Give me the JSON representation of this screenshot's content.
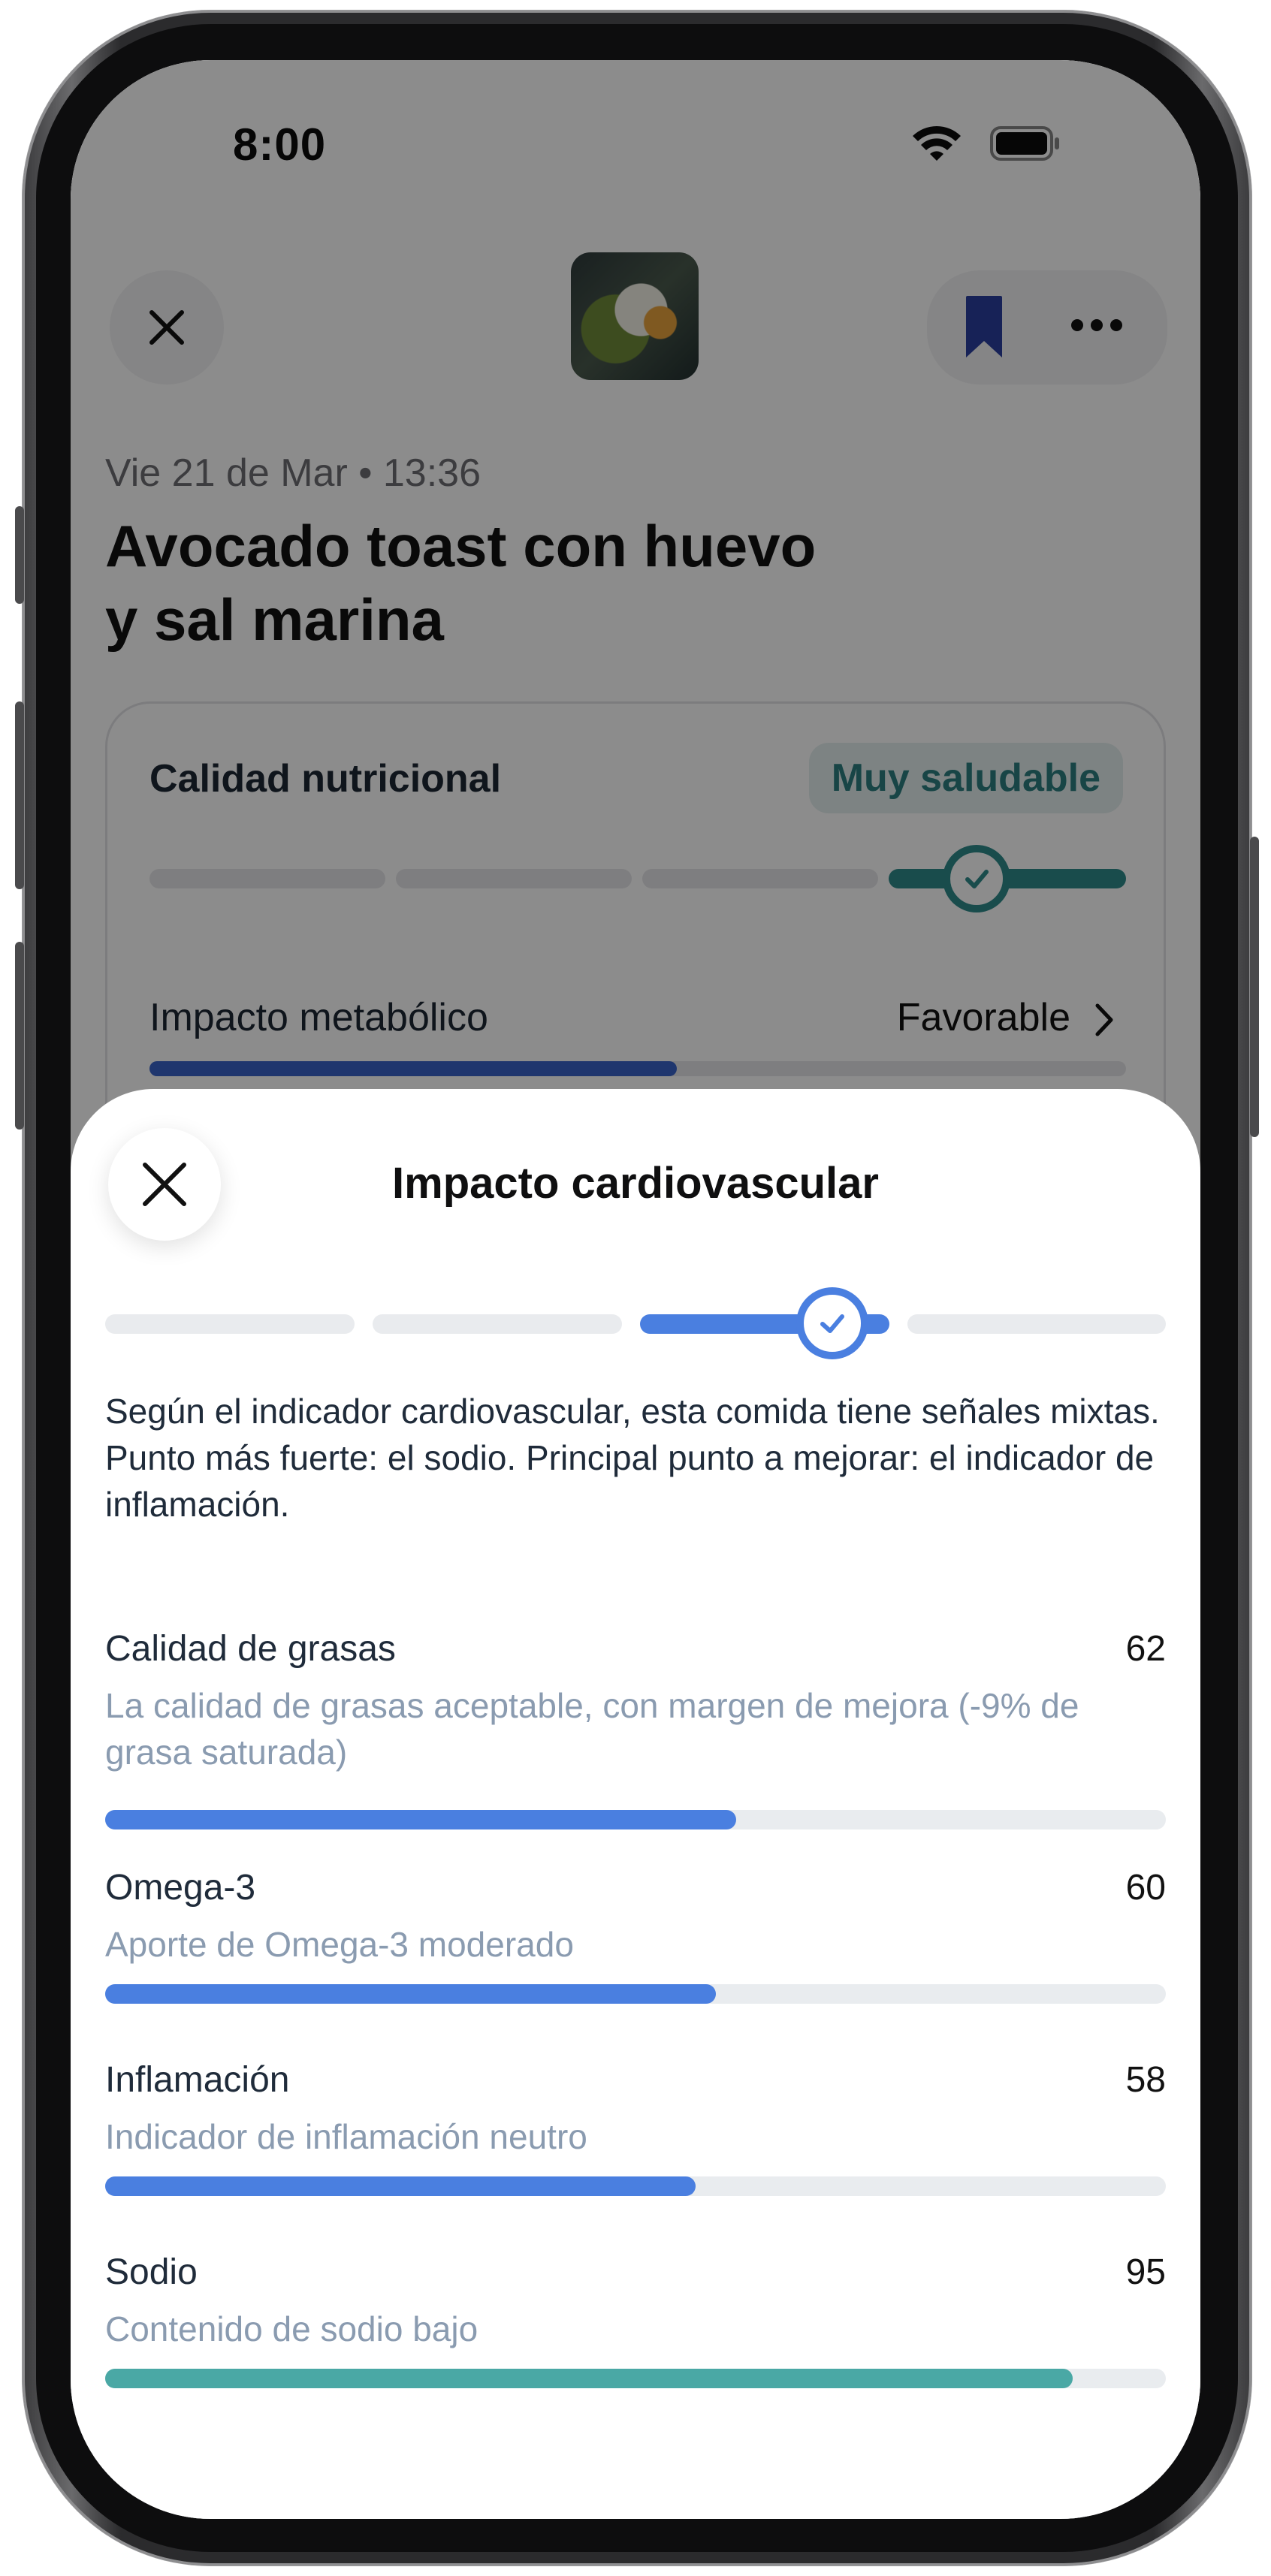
{
  "status_bar": {
    "time": "8:00"
  },
  "header": {
    "close_icon": "close-icon",
    "bookmark_icon": "bookmark-icon",
    "more_icon": "more-icon",
    "date": "Vie 21 de Mar • 13:36",
    "title_line1": "Avocado toast con huevo",
    "title_line2": "y sal marina"
  },
  "nutrition_card": {
    "label": "Calidad nutricional",
    "badge": "Muy saludable",
    "level": 4,
    "levels_total": 4,
    "metabolic_label": "Impacto metabólico",
    "metabolic_value": "Favorable",
    "metabolic_progress": 0.54
  },
  "sheet": {
    "title": "Impacto cardiovascular",
    "level": 3,
    "levels_total": 4,
    "summary": "Según el indicador cardiovascular, esta comida tiene señales mixtas. Punto más fuerte: el sodio. Principal punto a mejorar: el indicador de inflamación.",
    "metrics": [
      {
        "name": "Calidad de grasas",
        "value": "62",
        "description": "La calidad de grasas aceptable, con margen de mejora (-9% de grasa saturada)",
        "score": 62,
        "color": "#4a7fe0"
      },
      {
        "name": "Omega-3",
        "value": "60",
        "description": "Aporte de Omega-3 moderado",
        "score": 60,
        "color": "#4a7fe0"
      },
      {
        "name": "Inflamación",
        "value": "58",
        "description": "Indicador de inflamación neutro",
        "score": 58,
        "color": "#4a7fe0"
      },
      {
        "name": "Sodio",
        "value": "95",
        "description": "Contenido de sodio bajo",
        "score": 95,
        "color": "#4aa8a5"
      }
    ]
  },
  "colors": {
    "accent_blue": "#4a7fe0",
    "accent_teal": "#2f8a8b",
    "badge_bg": "#e3efef"
  }
}
